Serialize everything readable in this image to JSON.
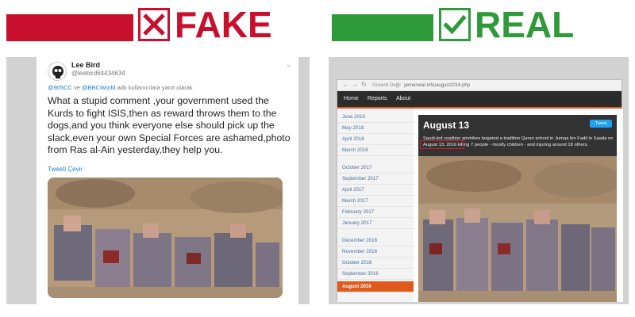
{
  "headers": {
    "fake": {
      "label": "FAKE",
      "color": "#c8102e",
      "icon": "x-mark-icon"
    },
    "real": {
      "label": "REAL",
      "color": "#2e9a3a",
      "icon": "check-mark-icon"
    }
  },
  "tweet": {
    "name": "Lee Bird",
    "handle": "@leebird64434634",
    "reply_mention_1": "@905CC",
    "reply_connector": " ve ",
    "reply_mention_2": "@BBCWorld",
    "reply_suffix": " adlı kullanıcılara yanıt olarak",
    "text": "What a stupid comment ,your government used the Kurds to fight ISIS,then as reward throws them to the dogs,and you think everyone else should pick up the slack,even your own Special Forces are ashamed,photo from Ras al-Ain yesterday,they help you.",
    "translate_label": "Tweeti Çevir"
  },
  "browser": {
    "secure_label": "Güvenli Değil",
    "url": "yemenwar.info/august2016.php",
    "nav": [
      "Home",
      "Reports",
      "About"
    ],
    "sidebar_items": [
      "June 2018",
      "May 2018",
      "April 2018",
      "March 2018",
      "October 2017",
      "September 2017",
      "April 2017",
      "March 2017",
      "February 2017",
      "January 2017",
      "December 2016",
      "November 2016",
      "October 2016",
      "September 2016",
      "August 2016"
    ],
    "active_item": "August 2016",
    "article_title": "August 13",
    "tweet_button": "Tweet",
    "article_body": "Saudi-led coalition airstrikes targeted a tradition Quran school in Jumaa bin Fadil in Saada on August 13, 2016 killing 7 people - mostly children - and injuring around 18 others."
  }
}
